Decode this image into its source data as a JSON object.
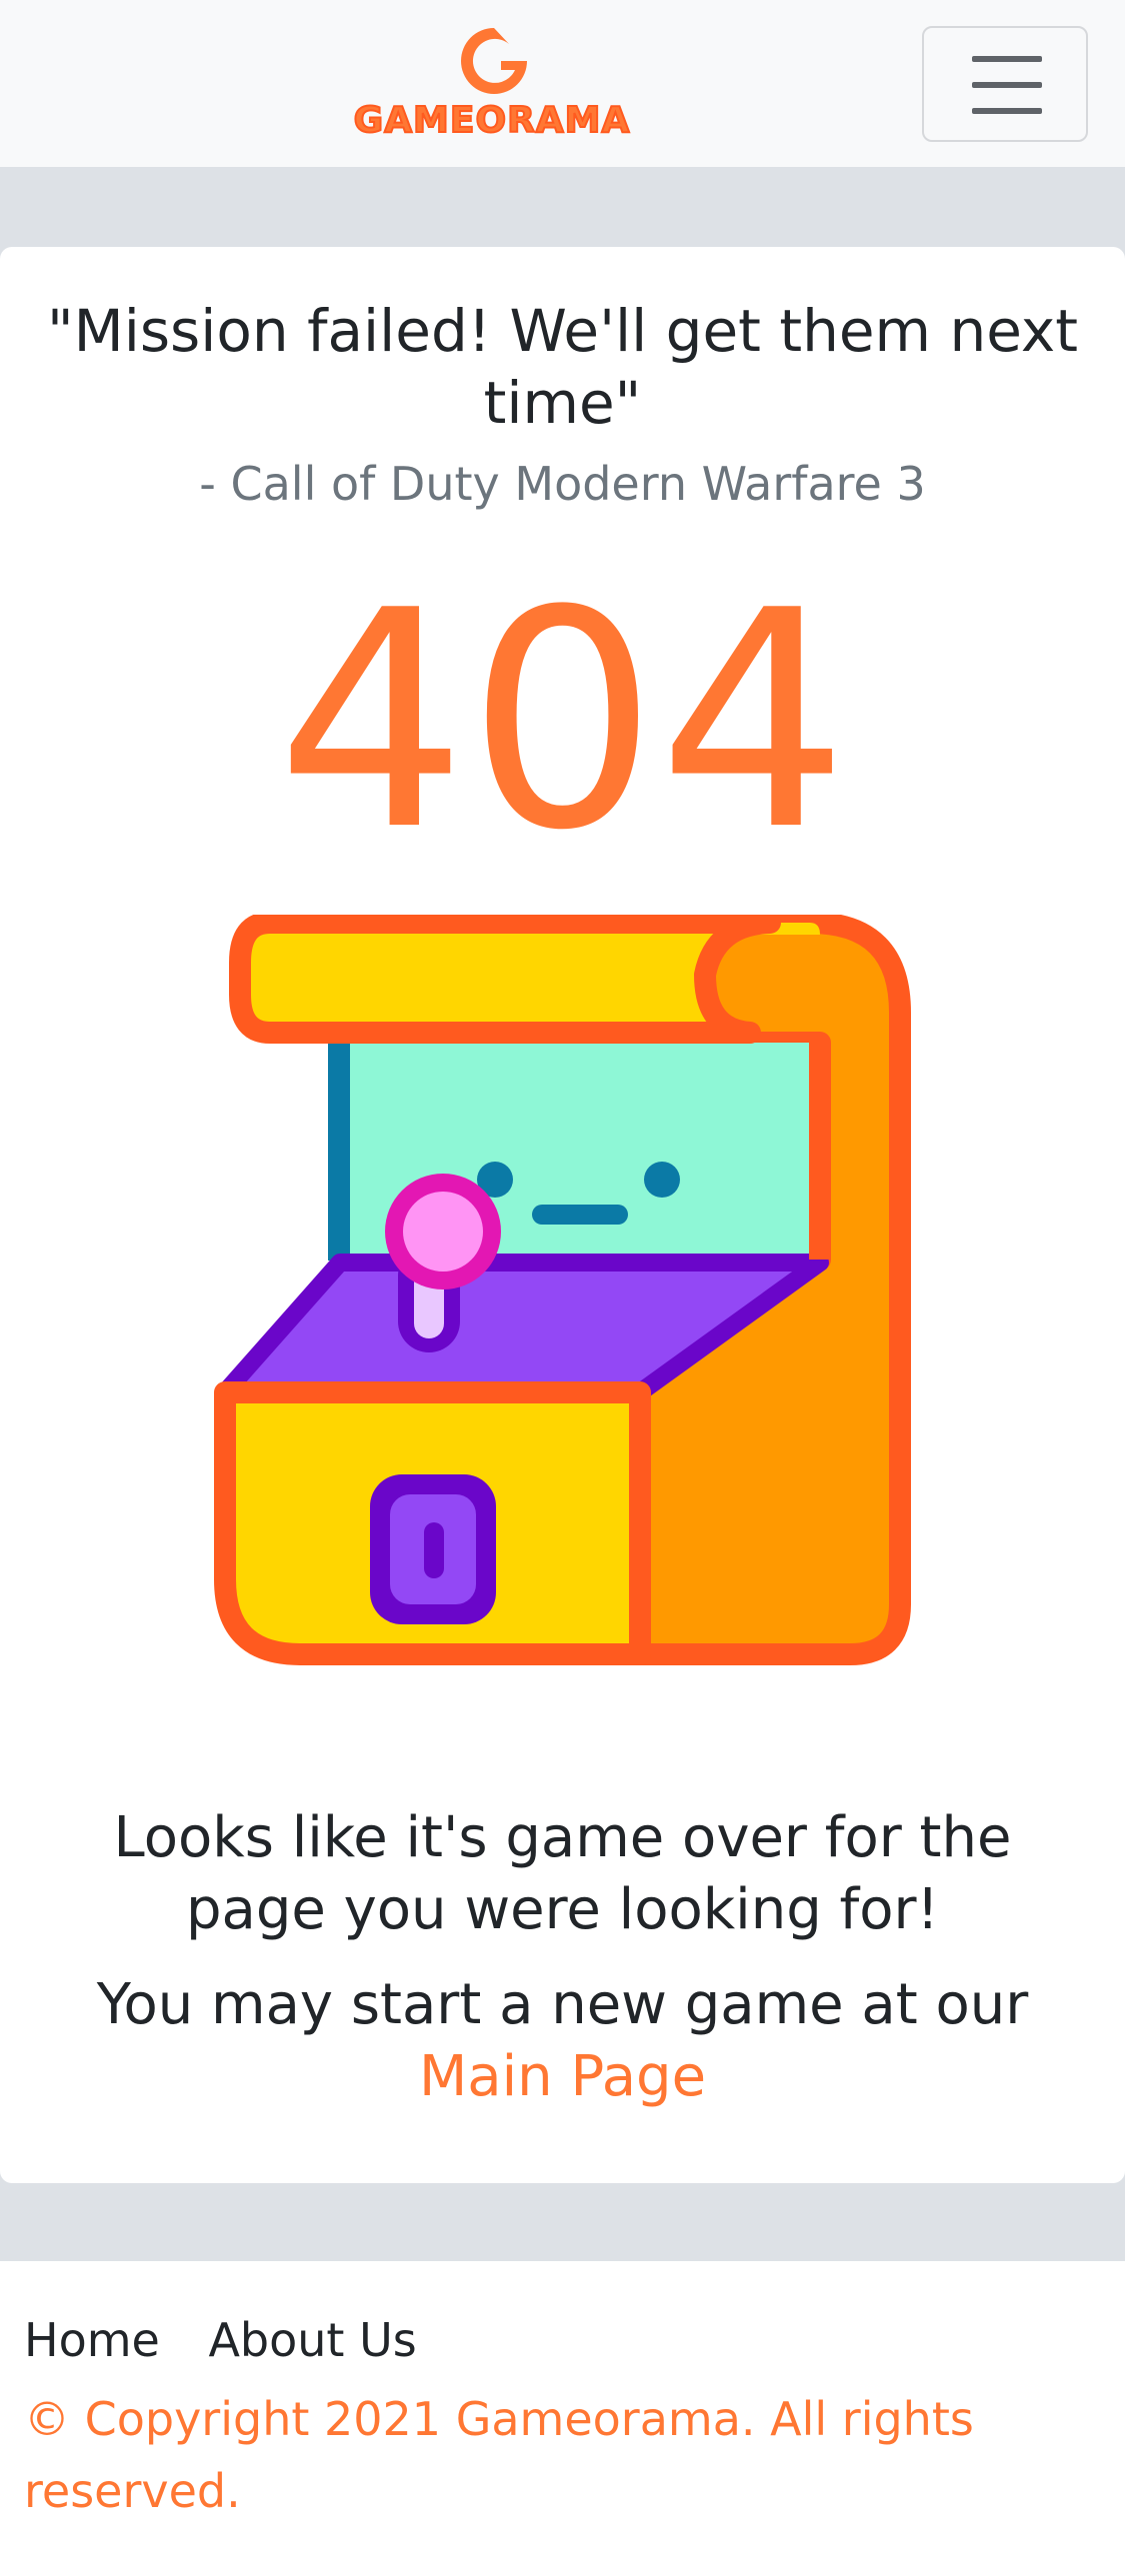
{
  "brand": {
    "name": "GAMEORAMA",
    "accent_color": "#ff7733"
  },
  "navbar": {
    "menu_icon": "hamburger-icon"
  },
  "error": {
    "quote": "\"Mission failed! We'll get them next time\"",
    "source": "- Call of Duty Modern Warfare 3",
    "code": "404",
    "illustration": "arcade-machine-icon",
    "message": "Looks like it's game over for the page you were looking for!",
    "redirect_prefix": "You may start a new game at our",
    "redirect_link": "Main Page"
  },
  "footer": {
    "links": [
      "Home",
      "About Us"
    ],
    "copyright": "© Copyright 2021 Gameorama. All rights reserved."
  }
}
